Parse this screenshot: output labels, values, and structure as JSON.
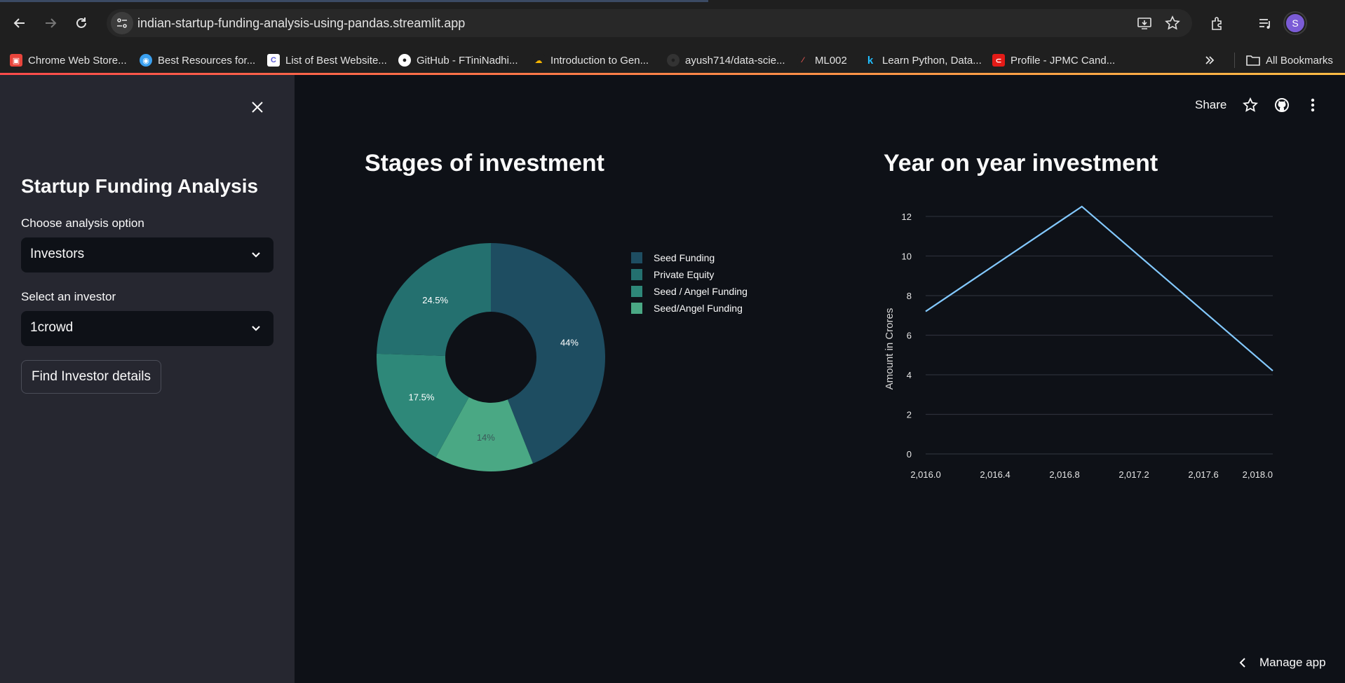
{
  "browser": {
    "url": "indian-startup-funding-analysis-using-pandas.streamlit.app",
    "profile_initial": "S",
    "bookmarks": [
      {
        "label": "Chrome Web Store...",
        "icon": "chrome-web-store-icon",
        "color": "#e8453c"
      },
      {
        "label": "Best Resources for...",
        "icon": "globe-icon",
        "color": "#3aa0f0"
      },
      {
        "label": "List of Best Website...",
        "icon": "c-logo-icon",
        "color": "#5b5bd6"
      },
      {
        "label": "GitHub - FTiniNadhi...",
        "icon": "github-icon",
        "color": "#ffffff"
      },
      {
        "label": "Introduction to Gen...",
        "icon": "google-cloud-icon",
        "color": "#f4b400"
      },
      {
        "label": "ayush714/data-scie...",
        "icon": "github-icon",
        "color": "#333333"
      },
      {
        "label": "ML002",
        "icon": "pen-icon",
        "color": "#d9534f"
      },
      {
        "label": "Learn Python, Data...",
        "icon": "k-icon",
        "color": "#20beff"
      },
      {
        "label": "Profile - JPMC Cand...",
        "icon": "oracle-icon",
        "color": "#e41b17"
      }
    ],
    "all_bookmarks": "All Bookmarks"
  },
  "sidebar": {
    "title": "Startup Funding Analysis",
    "analysis_label": "Choose analysis option",
    "analysis_value": "Investors",
    "investor_label": "Select an investor",
    "investor_value": "1crowd",
    "button": "Find Investor details"
  },
  "header": {
    "share": "Share"
  },
  "charts": {
    "left_title": "Stages of investment",
    "right_title": "Year on year investment"
  },
  "chart_data": [
    {
      "type": "pie",
      "title": "Stages of investment",
      "labels": [
        "Seed Funding",
        "Private Equity",
        "Seed / Angel Funding",
        "Seed/Angel Funding"
      ],
      "values": [
        44,
        14,
        17.5,
        24.5
      ],
      "display_labels": [
        "44%",
        "14%",
        "17.5%",
        "24.5%"
      ],
      "legend_order": [
        "Seed Funding",
        "Private Equity",
        "Seed / Angel Funding",
        "Seed/Angel Funding"
      ],
      "legend_colors": [
        "#1e4d61",
        "#24706f",
        "#2e8879",
        "#4aa884"
      ],
      "slice_colors": [
        "#1e4d61",
        "#4aa884",
        "#2e8879",
        "#24706f"
      ],
      "legend_placement": "right",
      "donut": true
    },
    {
      "type": "line",
      "title": "Year on year investment",
      "ylabel": "Amount in Crores",
      "x": [
        2016.0,
        2016.9,
        2018.0
      ],
      "y": [
        7.2,
        12.5,
        4.2
      ],
      "xlim": [
        2016.0,
        2018.0
      ],
      "ylim": [
        0,
        12
      ],
      "xticks": [
        2016.0,
        2016.4,
        2016.8,
        2017.2,
        2017.6,
        2018.0
      ],
      "xtick_labels": [
        "2,016.0",
        "2,016.4",
        "2,016.8",
        "2,017.2",
        "2,017.6",
        "2,018.0"
      ],
      "yticks": [
        0,
        2,
        4,
        6,
        8,
        10,
        12
      ],
      "grid": true,
      "color": "#83c9ff"
    }
  ],
  "footer": {
    "manage": "Manage app"
  }
}
